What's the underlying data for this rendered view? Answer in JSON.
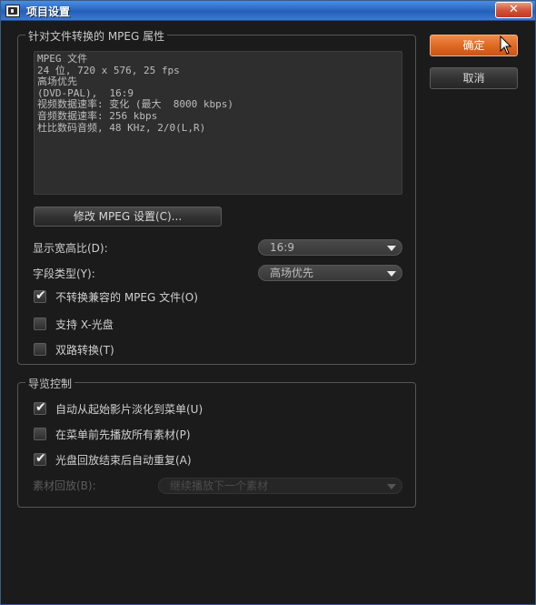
{
  "window": {
    "title": "项目设置",
    "close_label": "✕"
  },
  "buttons": {
    "ok_label": "确定",
    "cancel_label": "取消"
  },
  "mpeg_group": {
    "legend": "针对文件转换的 MPEG 属性",
    "info_lines": [
      "MPEG 文件",
      "24 位, 720 x 576, 25 fps",
      "高场优先",
      "(DVD-PAL),  16:9",
      "视频数据速率: 变化 (最大  8000 kbps)",
      "音频数据速率: 256 kbps",
      "杜比数码音频, 48 KHz, 2/0(L,R)"
    ],
    "modify_button_label": "修改 MPEG 设置(C)...",
    "aspect_ratio": {
      "label": "显示宽高比(D):",
      "value": "16:9"
    },
    "field_type": {
      "label": "字段类型(Y):",
      "value": "高场优先"
    },
    "checkboxes": [
      {
        "label": "不转换兼容的 MPEG 文件(O)",
        "checked": true
      },
      {
        "label": "支持 X-光盘",
        "checked": false
      },
      {
        "label": "双路转换(T)",
        "checked": false
      }
    ]
  },
  "preview_group": {
    "legend": "导览控制",
    "checkboxes": [
      {
        "label": "自动从起始影片淡化到菜单(U)",
        "checked": true
      },
      {
        "label": "在菜单前先播放所有素材(P)",
        "checked": false
      },
      {
        "label": "光盘回放结束后自动重复(A)",
        "checked": true
      }
    ],
    "playback": {
      "label": "素材回放(B):",
      "value": "继续播放下一个素材"
    }
  }
}
